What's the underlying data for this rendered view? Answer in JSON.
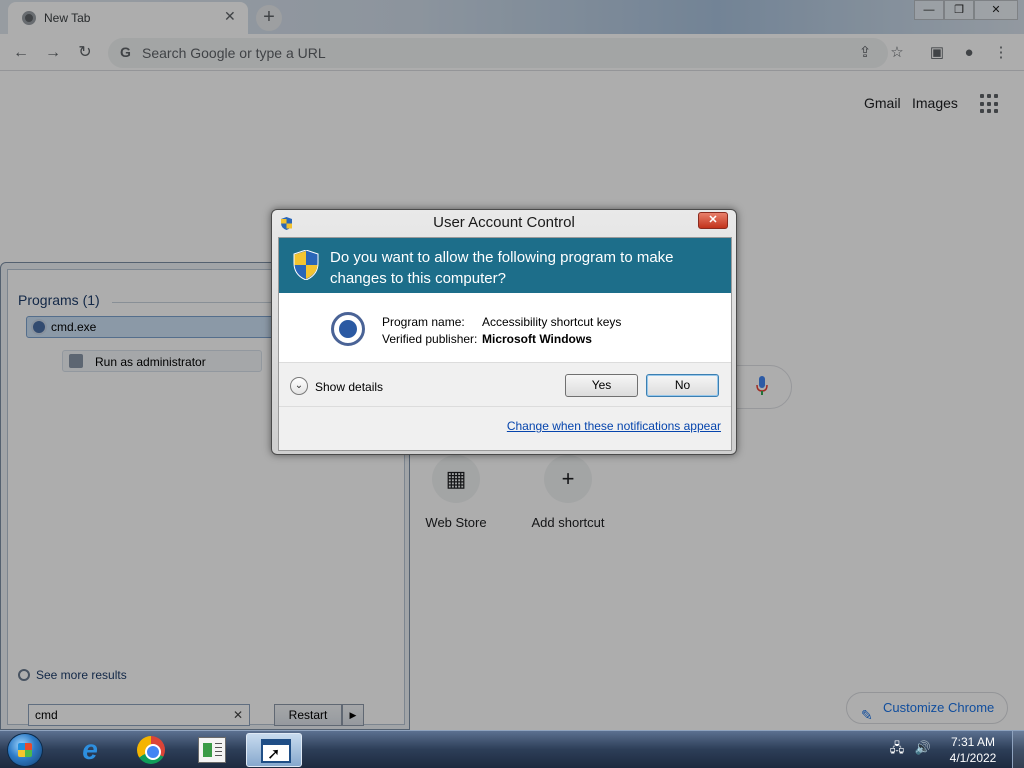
{
  "browser": {
    "tab_title": "New Tab",
    "tab_close": "✕",
    "new_tab": "+",
    "omnibox_placeholder": "Search Google or type a URL",
    "window_controls": {
      "minimize": "—",
      "maximize": "❐",
      "close": "✕"
    }
  },
  "new_tab_page": {
    "links": {
      "gmail": "Gmail",
      "images": "Images"
    },
    "shortcuts": [
      {
        "label": "Web Store",
        "icon": "web-store-icon"
      },
      {
        "label": "Add shortcut",
        "icon": "plus-icon",
        "glyph": "+"
      }
    ],
    "customize_label": "Customize Chrome"
  },
  "start_menu": {
    "programs_header": "Programs (1)",
    "program_item": "cmd.exe",
    "run_as_admin": "Run as administrator",
    "see_more": "See more results",
    "search_value": "cmd",
    "search_clear": "✕",
    "restart_label": "Restart",
    "restart_arrow": "▶"
  },
  "uac": {
    "title": "User Account Control",
    "close_label": "✕",
    "question": "Do you want to allow the following program to make changes to this computer?",
    "program_name_label": "Program name:",
    "program_name_value": "Accessibility shortcut keys",
    "publisher_label": "Verified publisher:",
    "publisher_value": "Microsoft Windows",
    "show_details": "Show details",
    "details_chevron": "⌄",
    "yes_label": "Yes",
    "no_label": "No",
    "change_link": "Change when these notifications appear",
    "colors": {
      "banner": "#1d6e8a",
      "link": "#0645ad"
    }
  },
  "taskbar": {
    "items": [
      {
        "name": "internet-explorer",
        "icon": "ie-icon",
        "glyph": "e"
      },
      {
        "name": "google-chrome",
        "icon": "chrome-icon"
      },
      {
        "name": "document-app",
        "icon": "document-icon"
      },
      {
        "name": "active-window",
        "icon": "window-icon",
        "active": true
      }
    ],
    "tray": {
      "network": "🖧",
      "volume": "🔊"
    },
    "clock": {
      "time": "7:31 AM",
      "date": "4/1/2022"
    }
  }
}
